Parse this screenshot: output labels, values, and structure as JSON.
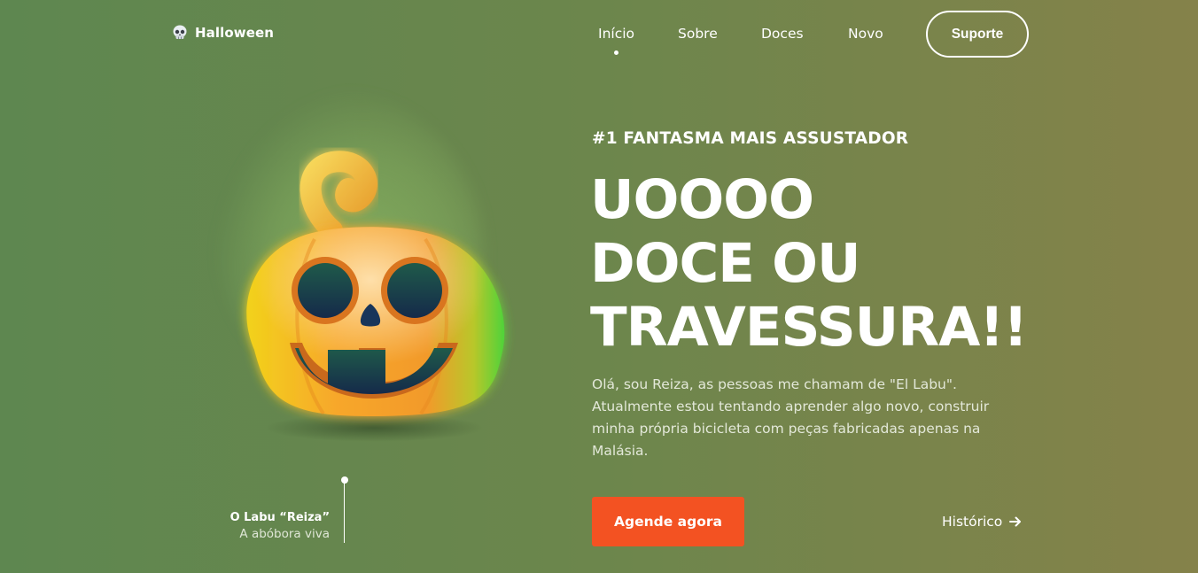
{
  "header": {
    "brand": "Halloween",
    "brand_icon": "skull-icon",
    "nav": [
      {
        "label": "Início",
        "active": true
      },
      {
        "label": "Sobre",
        "active": false
      },
      {
        "label": "Doces",
        "active": false
      },
      {
        "label": "Novo",
        "active": false
      }
    ],
    "support_label": "Suporte"
  },
  "hero": {
    "eyebrow": "#1 FANTASMA MAIS ASSUSTADOR",
    "headline": [
      "UOOOO",
      "DOCE OU",
      "TRAVESSURA!!"
    ],
    "description": "Olá, sou Reiza, as pessoas me chamam de \"El Labu\". Atualmente estou tentando aprender algo novo, construir minha própria bicicleta com peças fabricadas apenas na Malásia.",
    "cta_label": "Agende agora",
    "secondary_label": "Histórico",
    "secondary_icon": "arrow-right-icon"
  },
  "character": {
    "name": "O Labu “Reiza”",
    "subtitle": "A abóbora viva",
    "image_icon": "jack-o-lantern-icon"
  },
  "colors": {
    "cta": "#f35222",
    "background_start": "#5e8750",
    "background_end": "#85824a",
    "pumpkin": "#f6a22a"
  }
}
